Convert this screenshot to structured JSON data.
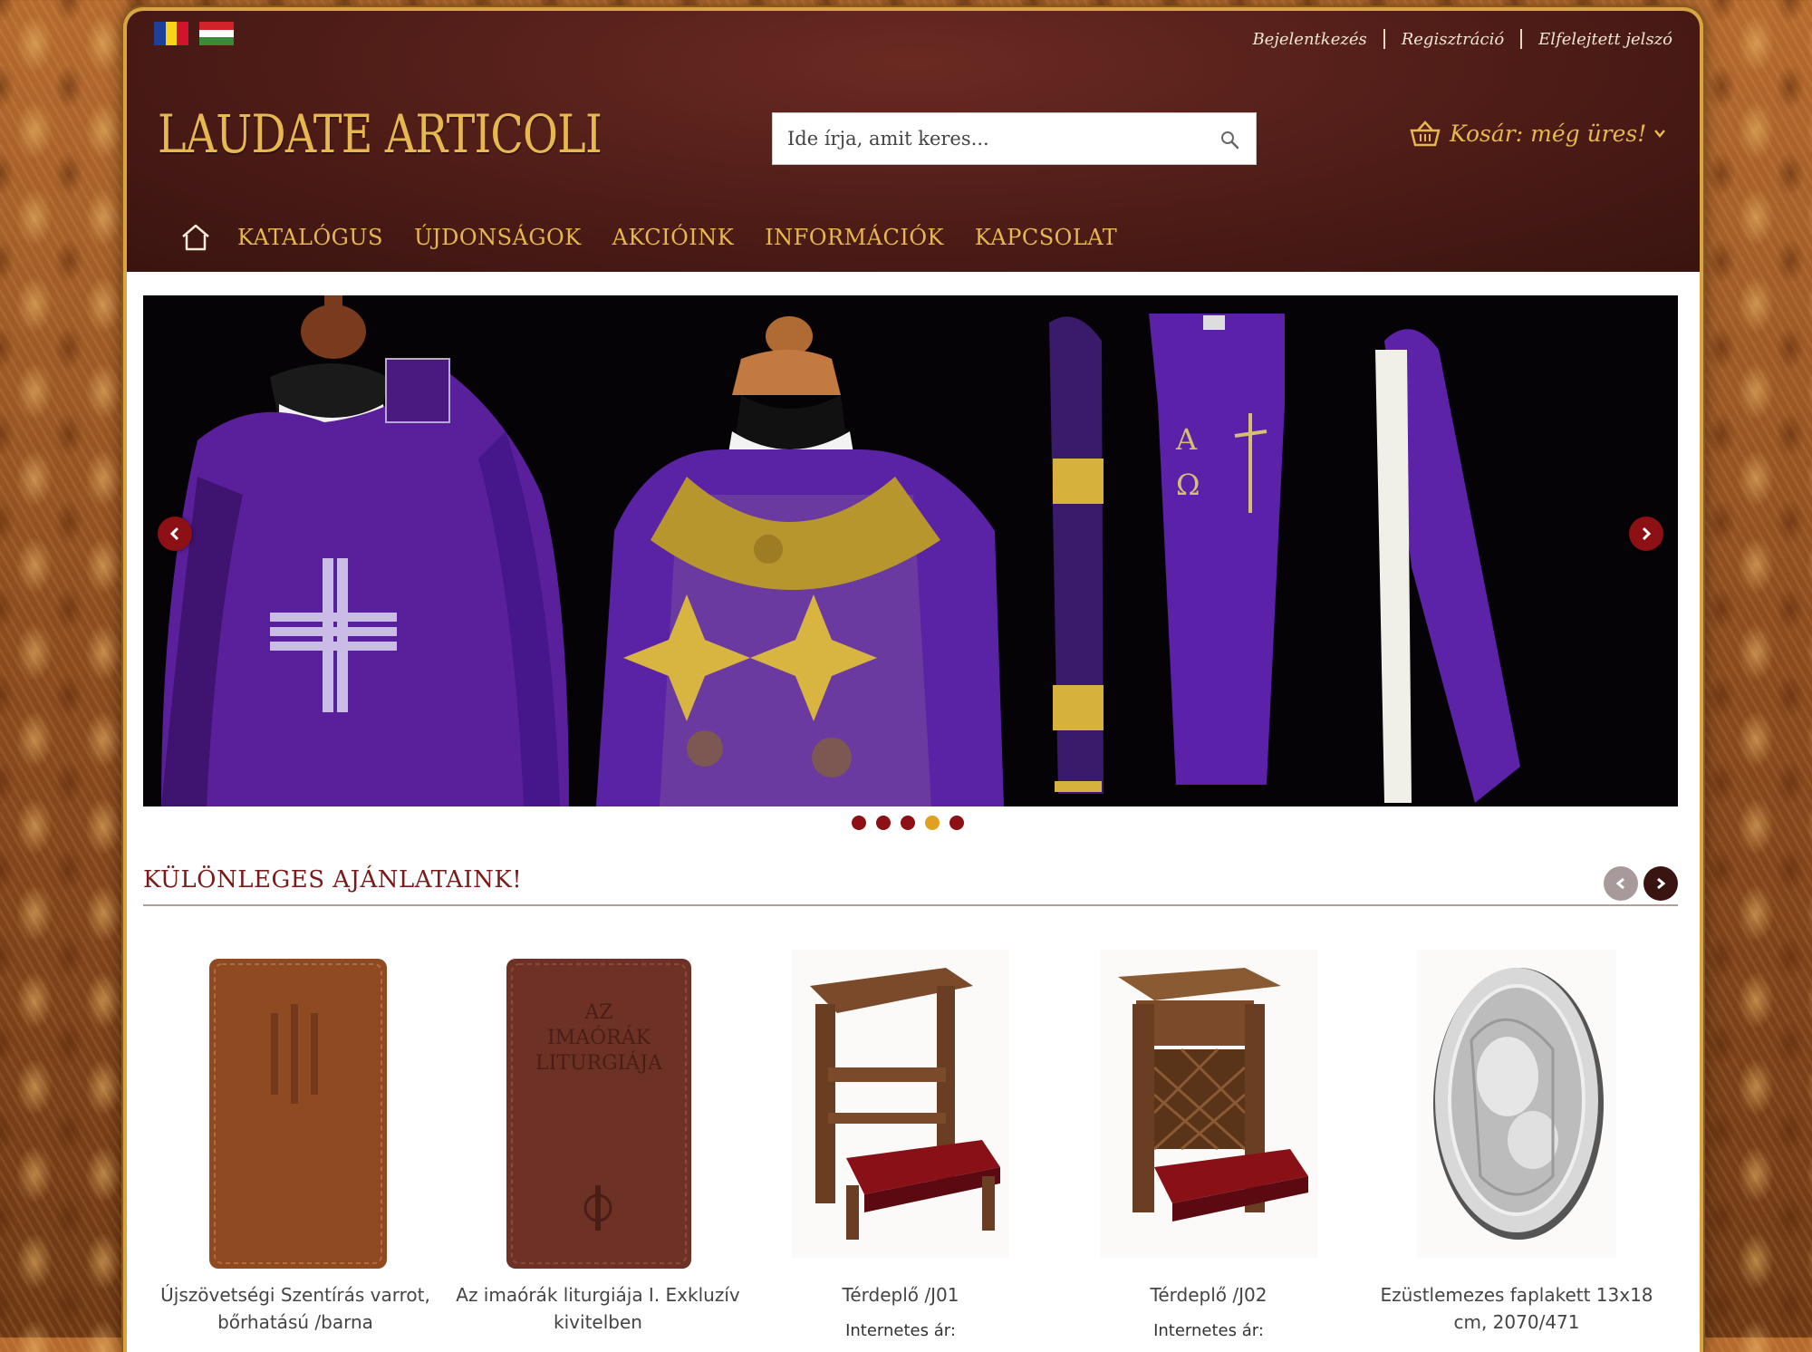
{
  "header": {
    "links": [
      "Bejelentkezés",
      "Regisztráció",
      "Elfelejtett jelszó"
    ],
    "logo": "LAUDATE ARTICOLI",
    "search_placeholder": "Ide írja, amit keres...",
    "cart_label": "Kosár: még üres!"
  },
  "nav": {
    "items": [
      "KATALÓGUS",
      "ÚJDONSÁGOK",
      "AKCIÓINK",
      "INFORMÁCIÓK",
      "KAPCSOLAT"
    ]
  },
  "slider": {
    "dots": 5,
    "active_dot": 4
  },
  "offers": {
    "title": "KÜLÖNLEGES AJÁNLATAINK!",
    "products": [
      {
        "name": "Újszövetségi Szentírás varrot, bőrhatású /barna",
        "price_label": ""
      },
      {
        "name": "Az imaórák liturgiája I. Exkluzív kivitelben",
        "price_label": "",
        "cover_text": [
          "AZ",
          "IMAÓRÁK",
          "LITURGIÁJA"
        ]
      },
      {
        "name": "Térdeplő /J01",
        "price_label": "Internetes ár:"
      },
      {
        "name": "Térdeplő /J02",
        "price_label": "Internetes ár:"
      },
      {
        "name": "Ezüstlemezes faplakett 13x18 cm, 2070/471",
        "price_label": ""
      }
    ]
  },
  "colors": {
    "header_bg": "#4e1c17",
    "accent_gold": "#e6b84f",
    "dot_red": "#8c1014",
    "dot_active": "#e0a020",
    "section_title": "#7a1a1a"
  }
}
